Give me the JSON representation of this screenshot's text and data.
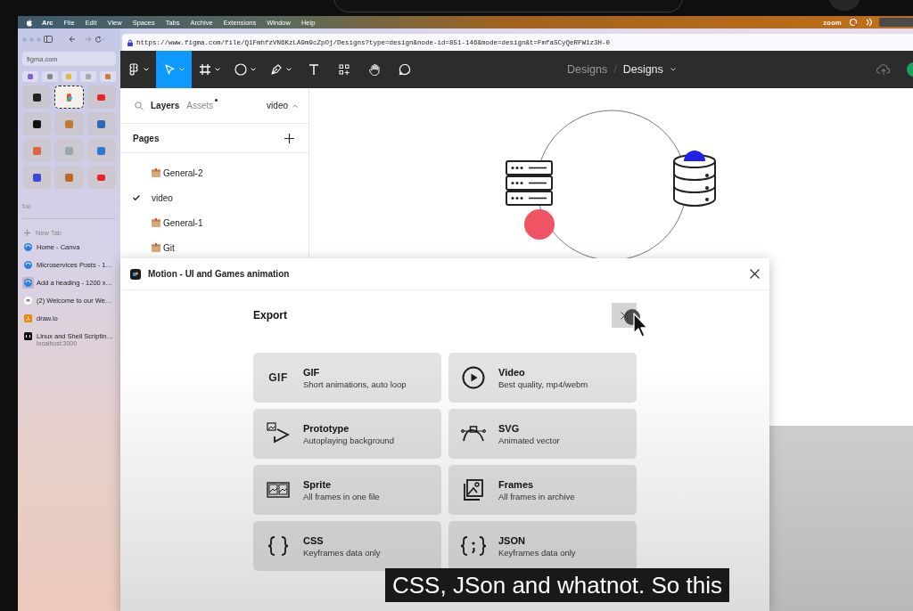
{
  "menu_bar": {
    "items": [
      "Arc",
      "File",
      "Edit",
      "View",
      "Spaces",
      "Tabs",
      "Archive",
      "Extensions",
      "Window",
      "Help"
    ],
    "status": "zoom"
  },
  "arc_sidebar": {
    "address": "figma.com",
    "space_label": "foo",
    "new_tab": "New Tab",
    "favorites": [
      {
        "selected": false
      },
      {
        "selected": true
      },
      {
        "selected": false
      },
      {
        "selected": false
      },
      {
        "selected": false
      },
      {
        "selected": false
      },
      {
        "selected": false
      },
      {
        "selected": false
      },
      {
        "selected": false
      },
      {
        "selected": false
      },
      {
        "selected": false
      },
      {
        "selected": false
      }
    ],
    "tabs": [
      {
        "kind": "globe",
        "title": "Home - Canva",
        "selected": false
      },
      {
        "kind": "globe",
        "title": "Microservices Posts - 1…",
        "selected": false
      },
      {
        "kind": "globe",
        "title": "Add a heading - 1200 x…",
        "selected": true
      },
      {
        "kind": "chat",
        "title": "(2) Welcome to our We…",
        "selected": false
      },
      {
        "kind": "drawio",
        "title": "draw.io",
        "selected": false
      },
      {
        "kind": "terminal",
        "title": "Linux and Shell Scriptin…",
        "subtitle": "localhost:3000",
        "selected": false
      }
    ]
  },
  "address_bar": {
    "url": "https://www.figma.com/file/Q1FmhfzVN6KzLA9m9cZpOj/Designs?type=design&node-id=851-146&mode=design&t=FmfaSCyQeRFW1z3H-0"
  },
  "toolbar": {
    "tools": [
      {
        "kind": "figma",
        "selected": false,
        "dropdown": true
      },
      {
        "kind": "move",
        "selected": true,
        "dropdown": true
      },
      {
        "kind": "frame",
        "selected": false,
        "dropdown": true
      },
      {
        "kind": "ellipse",
        "selected": false,
        "dropdown": true
      },
      {
        "kind": "pen",
        "selected": false,
        "dropdown": true
      },
      {
        "kind": "text",
        "selected": false,
        "dropdown": false
      },
      {
        "kind": "resources",
        "selected": false,
        "dropdown": false
      },
      {
        "kind": "hand",
        "selected": false,
        "dropdown": false
      },
      {
        "kind": "comment",
        "selected": false,
        "dropdown": false
      }
    ],
    "breadcrumb": {
      "project": "Designs",
      "separator": "/",
      "file": "Designs"
    }
  },
  "layers_panel": {
    "tabs": [
      {
        "label": "Layers",
        "selected": true
      },
      {
        "label": "Assets",
        "selected": false
      }
    ],
    "page_switch": "video",
    "pages_title": "Pages",
    "pages": [
      {
        "kind": "box",
        "name": "General-2",
        "selected": false
      },
      {
        "kind": "plain",
        "name": "video",
        "selected": true
      },
      {
        "kind": "box",
        "name": "General-1",
        "selected": false
      },
      {
        "kind": "box",
        "name": "Git",
        "selected": false
      }
    ]
  },
  "plugin_dialog": {
    "title": "Motion - UI and Games animation",
    "heading": "Export",
    "options": [
      {
        "kind": "gif",
        "icon_text": "GIF",
        "title": "GIF",
        "description": "Short animations, auto loop"
      },
      {
        "kind": "video",
        "title": "Video",
        "description": "Best quality, mp4/webm"
      },
      {
        "kind": "prototype",
        "title": "Prototype",
        "description": "Autoplaying background"
      },
      {
        "kind": "svg",
        "title": "SVG",
        "description": "Animated vector"
      },
      {
        "kind": "sprite",
        "title": "Sprite",
        "description": "All frames in one file"
      },
      {
        "kind": "frames",
        "title": "Frames",
        "description": "All frames in archive"
      },
      {
        "kind": "css",
        "title": "CSS",
        "description": "Keyframes data only"
      },
      {
        "kind": "json",
        "title": "JSON",
        "description": "Keyframes data only"
      }
    ]
  },
  "caption": "CSS, JSon and whatnot. So this"
}
